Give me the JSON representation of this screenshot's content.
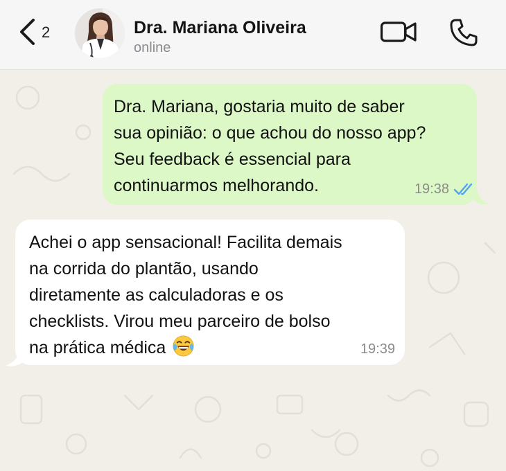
{
  "header": {
    "back_count": "2",
    "contact_name": "Dra. Mariana Oliveira",
    "status": "online",
    "icons": {
      "back": "chevron-left-icon",
      "avatar": "profile-photo",
      "video": "video-camera-icon",
      "phone": "phone-icon"
    }
  },
  "messages": [
    {
      "direction": "outgoing",
      "lines": [
        "Dra. Mariana, gostaria muito de saber",
        "sua opinião: o que achou do nosso app?",
        "Seu feedback é essencial para",
        "continuarmos melhorando."
      ],
      "time": "19:38",
      "status_icon": "double-check-read-icon"
    },
    {
      "direction": "incoming",
      "lines": [
        "Achei o app sensacional! Facilita demais",
        "na corrida do plantão, usando",
        "diretamente as calculadoras e os",
        "checklists. Virou meu parceiro de bolso",
        "na prática médica"
      ],
      "trailing_emoji": "tears-of-joy-emoji",
      "time": "19:39"
    }
  ],
  "colors": {
    "header_bg": "#f6f6f6",
    "chat_bg": "#f2efe8",
    "outgoing_bubble": "#dcf8c6",
    "incoming_bubble": "#ffffff",
    "read_tick": "#4fa3f7",
    "secondary_text": "#8a8a8e"
  }
}
